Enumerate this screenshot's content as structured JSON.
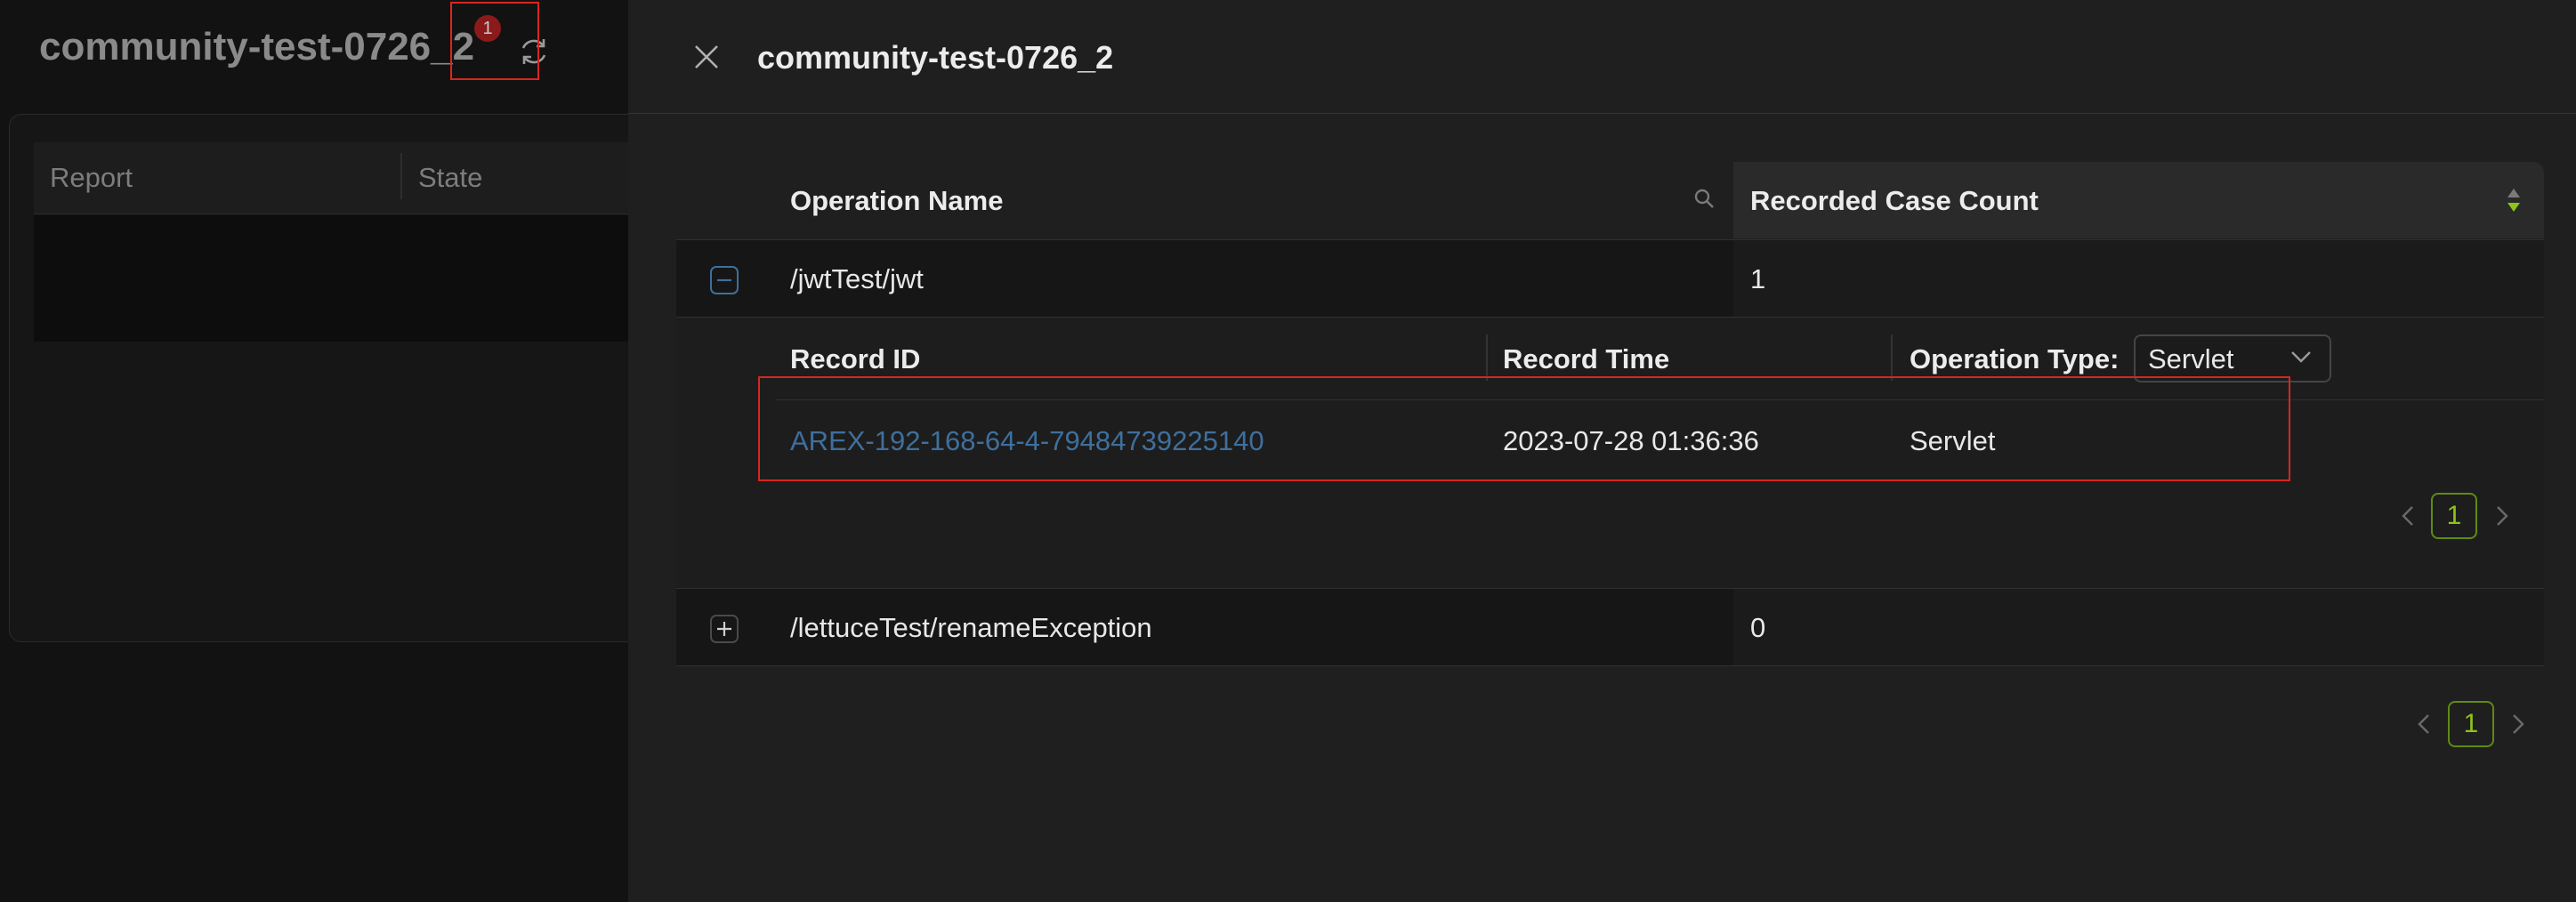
{
  "background_page": {
    "title": "community-test-0726_2",
    "badge_count": "1",
    "columns": [
      "Report",
      "State"
    ]
  },
  "drawer": {
    "title": "community-test-0726_2",
    "table": {
      "headers": {
        "operation_name": "Operation Name",
        "recorded_case_count": "Recorded Case Count"
      },
      "rows": [
        {
          "operation_name": "/jwtTest/jwt",
          "recorded_case_count": "1",
          "expanded": true,
          "sub_table": {
            "headers": {
              "record_id": "Record ID",
              "record_time": "Record Time",
              "operation_type": "Operation Type:"
            },
            "operation_type_filter": "Servlet",
            "records": [
              {
                "record_id": "AREX-192-168-64-4-79484739225140",
                "record_time": "2023-07-28 01:36:36",
                "operation_type": "Servlet"
              }
            ],
            "pagination": {
              "current_page": "1"
            }
          }
        },
        {
          "operation_name": "/lettuceTest/renameException",
          "recorded_case_count": "0",
          "expanded": false
        }
      ],
      "pagination": {
        "current_page": "1"
      }
    }
  },
  "colors": {
    "highlight_red": "#d6271f",
    "link_blue": "#3f6f9d",
    "pager_green": "#8fc21a",
    "badge_red": "#8b1a1a",
    "drawer_bg": "#1f1f1f"
  },
  "icons": [
    "refresh-icon",
    "close-icon",
    "search-icon",
    "sort-icon",
    "collapse-icon",
    "expand-icon",
    "chevron-down-icon",
    "chevron-left-icon",
    "chevron-right-icon"
  ]
}
